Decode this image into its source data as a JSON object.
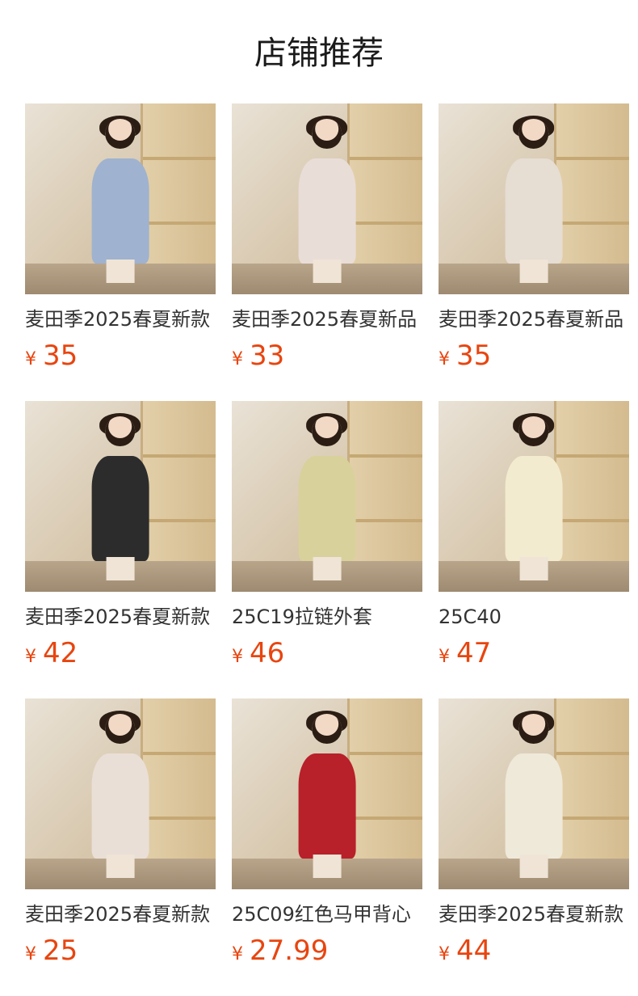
{
  "section": {
    "title": "店铺推荐"
  },
  "products": [
    {
      "name": "麦田季2025春夏新款",
      "currency": "¥",
      "price": "35",
      "outfit_color": "#9fb2cf"
    },
    {
      "name": "麦田季2025春夏新品",
      "currency": "¥",
      "price": "33",
      "outfit_color": "#e9ddd8"
    },
    {
      "name": "麦田季2025春夏新品",
      "currency": "¥",
      "price": "35",
      "outfit_color": "#e6ddd3"
    },
    {
      "name": "麦田季2025春夏新款",
      "currency": "¥",
      "price": "42",
      "outfit_color": "#2c2c2c"
    },
    {
      "name": "25C19拉链外套",
      "currency": "¥",
      "price": "46",
      "outfit_color": "#d8d19c"
    },
    {
      "name": "25C40",
      "currency": "¥",
      "price": "47",
      "outfit_color": "#f3ebcf"
    },
    {
      "name": "麦田季2025春夏新款",
      "currency": "¥",
      "price": "25",
      "outfit_color": "#eadfd6"
    },
    {
      "name": "25C09红色马甲背心",
      "currency": "¥",
      "price": "27.99",
      "outfit_color": "#b8202a"
    },
    {
      "name": "麦田季2025春夏新款",
      "currency": "¥",
      "price": "44",
      "outfit_color": "#efe9da"
    }
  ],
  "colors": {
    "price": "#e8450f",
    "title": "#1a1a1a",
    "name": "#333333"
  }
}
